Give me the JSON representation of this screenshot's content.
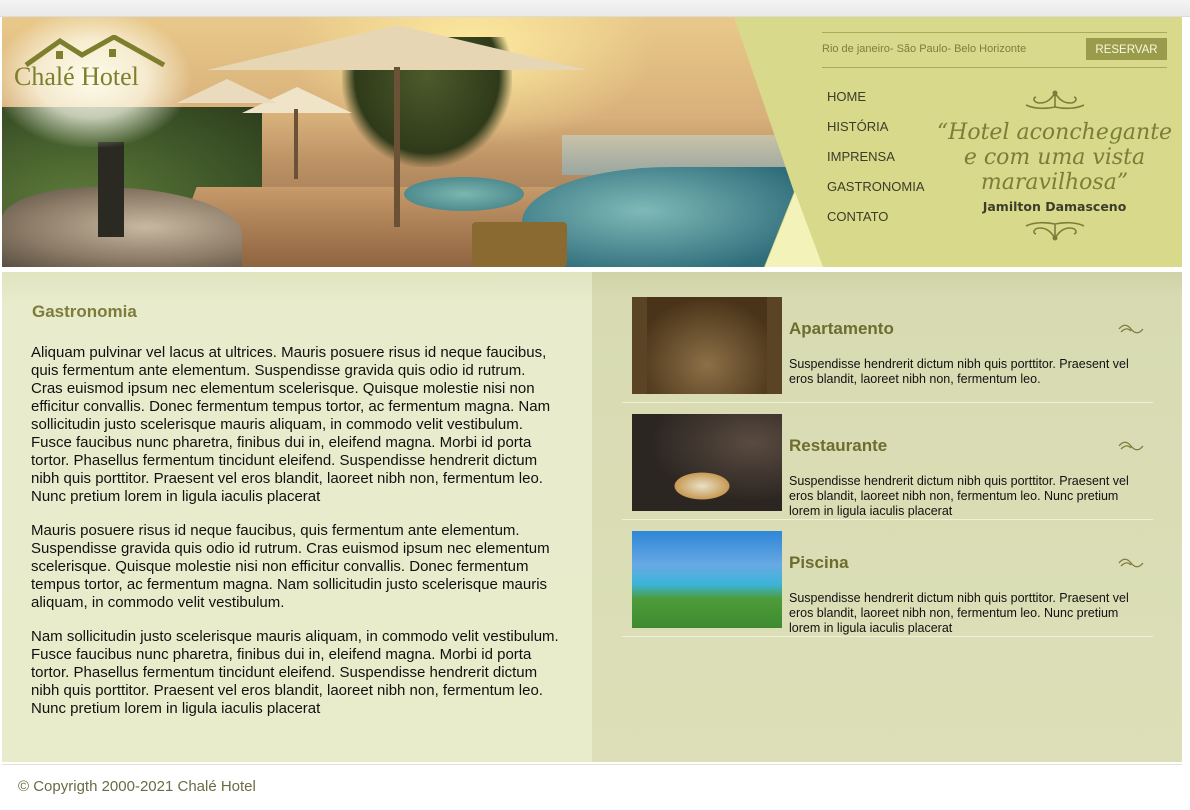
{
  "header": {
    "logo_text": "Chalé Hotel",
    "locations": "Rio de janeiro- São Paulo- Belo Horizonte",
    "reserve_label": "RESERVAR",
    "nav": [
      "HOME",
      "HISTÓRIA",
      "IMPRENSA",
      "GASTRONOMIA",
      "CONTATO"
    ],
    "quote": "“Hotel aconchegante e com uma vista maravilhosa”",
    "quote_author": "Jamilton Damasceno"
  },
  "main": {
    "title": "Gastronomia",
    "paragraphs": [
      "Aliquam pulvinar vel lacus at ultrices. Mauris posuere risus id neque faucibus, quis fermentum ante elementum. Suspendisse gravida quis odio id rutrum. Cras euismod ipsum nec elementum scelerisque. Quisque molestie nisi non efficitur convallis. Donec fermentum tempus tortor, ac fermentum magna. Nam sollicitudin justo scelerisque mauris aliquam, in commodo velit vestibulum. Fusce faucibus nunc pharetra, finibus dui in, eleifend magna. Morbi id porta tortor. Phasellus fermentum tincidunt eleifend. Suspendisse hendrerit dictum nibh quis porttitor. Praesent vel eros blandit, laoreet nibh non, fermentum leo. Nunc pretium lorem in ligula iaculis placerat",
      "Mauris posuere risus id neque faucibus, quis fermentum ante elementum. Suspendisse gravida quis odio id rutrum. Cras euismod ipsum nec elementum scelerisque. Quisque molestie nisi non efficitur convallis. Donec fermentum tempus tortor, ac fermentum magna. Nam sollicitudin justo scelerisque mauris aliquam, in commodo velit vestibulum.",
      "Nam sollicitudin justo scelerisque mauris aliquam, in commodo velit vestibulum. Fusce faucibus nunc pharetra, finibus dui in, eleifend magna. Morbi id porta tortor. Phasellus fermentum tincidunt eleifend. Suspendisse hendrerit dictum nibh quis porttitor. Praesent vel eros blandit, laoreet nibh non, fermentum leo. Nunc pretium lorem in ligula iaculis placerat"
    ]
  },
  "sidebar": {
    "cards": [
      {
        "title": "Apartamento",
        "text": "Suspendisse hendrerit dictum nibh quis porttitor. Praesent vel eros blandit, laoreet nibh non, fermentum leo."
      },
      {
        "title": "Restaurante",
        "text": "Suspendisse hendrerit dictum nibh quis porttitor. Praesent vel eros blandit, laoreet nibh non, fermentum leo. Nunc pretium lorem in ligula iaculis placerat"
      },
      {
        "title": "Piscina",
        "text": "Suspendisse hendrerit dictum nibh quis porttitor. Praesent vel eros blandit, laoreet nibh non, fermentum leo. Nunc pretium lorem in ligula iaculis placerat"
      }
    ]
  },
  "footer": {
    "copyright": "© Copyrigth 2000-2021 Chalé Hotel"
  },
  "colors": {
    "accent": "#7c7d3b",
    "button": "#9b9c4b",
    "header_bg": "#d8d98a"
  }
}
